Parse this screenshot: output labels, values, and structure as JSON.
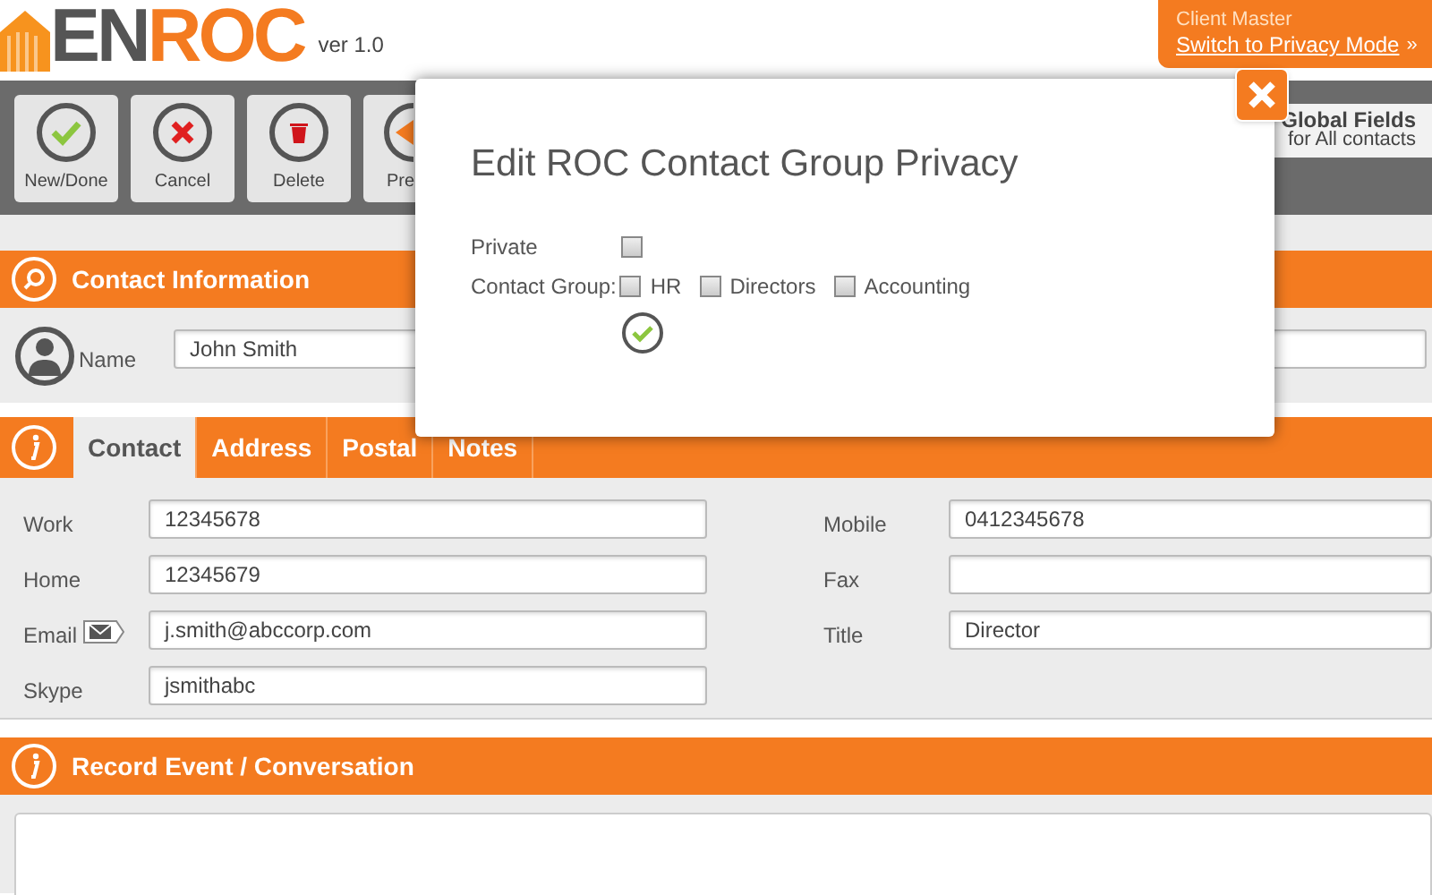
{
  "header": {
    "logo_dark": "EN",
    "logo_orange": "ROC",
    "version": "ver 1.0",
    "account": {
      "name": "Client Master",
      "link": "Switch to Privacy Mode",
      "link_suffix": "»"
    }
  },
  "toolbar": {
    "buttons": [
      {
        "label": "New/Done",
        "kind": "done"
      },
      {
        "label": "Cancel",
        "kind": "cancel"
      },
      {
        "label": "Delete",
        "kind": "delete"
      },
      {
        "label": "Pre",
        "kind": "prev"
      }
    ],
    "global_fields": {
      "title": "Global Fields",
      "subtitle": "for All contacts"
    }
  },
  "contact_information": {
    "title": "Contact Information",
    "name_label": "Name",
    "name_value": "John Smith"
  },
  "tabs": [
    {
      "label": "Contact",
      "selected": true
    },
    {
      "label": "Address",
      "selected": false
    },
    {
      "label": "Postal",
      "selected": false
    },
    {
      "label": "Notes",
      "selected": false
    }
  ],
  "fields_left": [
    {
      "label": "Work",
      "value": "12345678",
      "kind": "plain"
    },
    {
      "label": "Home",
      "value": "12345679",
      "kind": "plain"
    },
    {
      "label": "Email",
      "value": "j.smith@abccorp.com",
      "kind": "email"
    },
    {
      "label": "Skype",
      "value": "jsmithabc",
      "kind": "plain"
    }
  ],
  "fields_right": [
    {
      "label": "Mobile",
      "value": "0412345678"
    },
    {
      "label": "Fax"
    },
    {
      "label": "Title",
      "value": "Director"
    }
  ],
  "record_event": {
    "title": "Record Event / Conversation"
  },
  "modal": {
    "title": "Edit ROC Contact Group Privacy",
    "private_label": "Private",
    "private_checked": false,
    "group_label": "Contact Group:",
    "groups": [
      {
        "label": "HR",
        "checked": false
      },
      {
        "label": "Directors",
        "checked": false
      },
      {
        "label": "Accounting",
        "checked": false
      }
    ]
  }
}
